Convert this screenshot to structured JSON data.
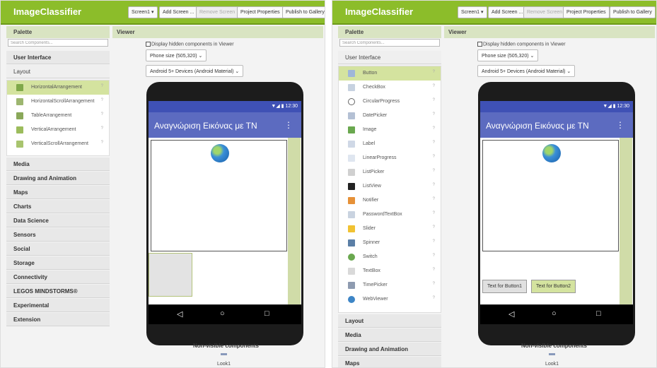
{
  "toolbar": {
    "app_title": "ImageClassifier",
    "screen_button": "Screen1 ▾",
    "add_screen": "Add Screen ...",
    "remove_screen": "Remove Screen",
    "project_properties": "Project Properties",
    "publish": "Publish to Gallery"
  },
  "palette": {
    "title": "Palette",
    "search_placeholder": "Search Components...",
    "categories": [
      "User Interface",
      "Layout",
      "Media",
      "Drawing and Animation",
      "Maps",
      "Charts",
      "Data Science",
      "Sensors",
      "Social",
      "Storage",
      "Connectivity",
      "LEGOS MINDSTORMS®",
      "Experimental",
      "Extension"
    ],
    "layout_components": [
      "HorizontalArrangement",
      "HorizontalScrollArrangement",
      "TableArrangement",
      "VerticalArrangement",
      "VerticalScrollArrangement"
    ],
    "ui_components": [
      "Button",
      "CheckBox",
      "CircularProgress",
      "DatePicker",
      "Image",
      "Label",
      "LinearProgress",
      "ListPicker",
      "ListView",
      "Notifier",
      "PasswordTextBox",
      "Slider",
      "Spinner",
      "Switch",
      "TextBox",
      "TimePicker",
      "WebViewer"
    ],
    "help": "?"
  },
  "viewer": {
    "title": "Viewer",
    "display_hidden": "Display hidden components in Viewer",
    "phone_size": "Phone size (505,320)",
    "theme": "Android 5+ Devices (Android Material)",
    "clock": "12:30",
    "app_screen_title": "Αναγνώριση Εικόνας με ΤΝ",
    "kebab": "⋮",
    "nav_back": "◁",
    "nav_home": "○",
    "nav_recent": "□",
    "button1": "Text for Button1",
    "button2": "Text for Button2",
    "nonvisible_title": "Non-visible components",
    "nonvisible_item": "Look1"
  },
  "colors": {
    "brand": "#8cbd2a",
    "header": "#d9e4c2",
    "selected": "#d4e39f",
    "phone_bar": "#3f51b5"
  }
}
